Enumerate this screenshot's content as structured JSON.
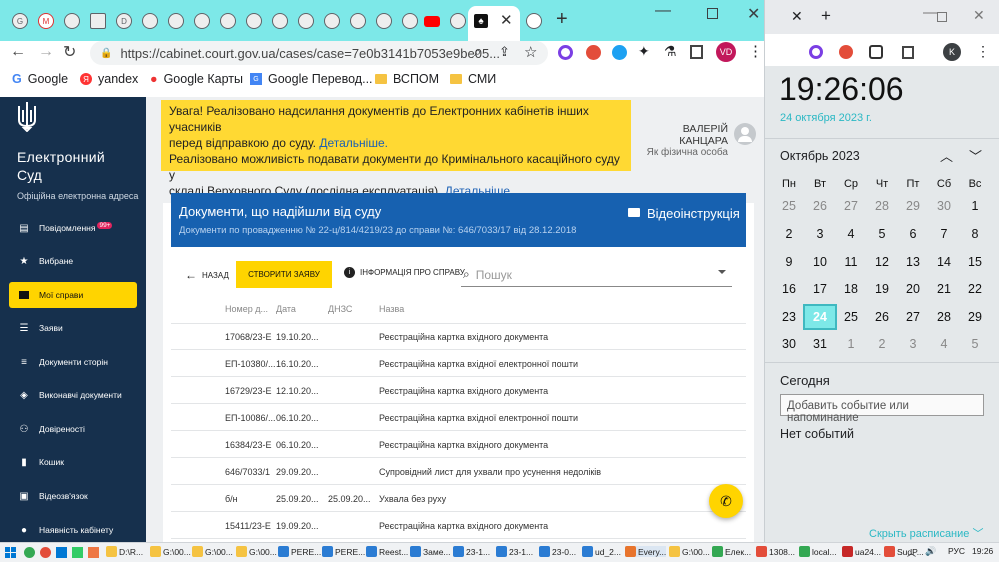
{
  "browser": {
    "address": "https://cabinet.court.gov.ua/cases/case=7e0b3141b7053e9be05...",
    "profile_initials": "VD",
    "bookmarks": [
      "Google",
      "yandex",
      "Google Карты",
      "Google Перевод...",
      "ВСПОМ",
      "СМИ"
    ],
    "brand_color": "#7de8e8"
  },
  "sidebar": {
    "brand_line1": "Електронний",
    "brand_line2": "Суд",
    "subtitle": "Офіційна електронна адреса",
    "items": [
      {
        "label": "Повідомлення",
        "badge": "99+",
        "icon": "chat-icon"
      },
      {
        "label": "Вибране",
        "icon": "star-icon"
      },
      {
        "label": "Мої справи",
        "icon": "folder-icon"
      },
      {
        "label": "Заяви",
        "icon": "list-icon"
      },
      {
        "label": "Документи сторін",
        "icon": "document-icon"
      },
      {
        "label": "Виконавчі документи",
        "icon": "stack-icon"
      },
      {
        "label": "Довіреності",
        "icon": "people-icon"
      },
      {
        "label": "Кошик",
        "icon": "trash-icon"
      },
      {
        "label": "Відеозв'язок",
        "icon": "video-icon"
      },
      {
        "label": "Наявність кабінету",
        "icon": "person-icon"
      }
    ]
  },
  "notice": {
    "line1": "Увага! Реалізовано надсилання документів до Електронних кабінетів інших учасників",
    "line2a": "перед відправкою до суду.",
    "link": "Детальніше.",
    "line3": "Реалізовано можливість подавати документи до Кримінального касаційного суду у",
    "line4a": "складі Верховного Суду (дослідна експлуатація).",
    "link2": "Детальніше."
  },
  "user": {
    "name": "ВАЛЕРІЙ КАНЦАРА",
    "role": "Як фізична особа"
  },
  "panel": {
    "title": "Документи, що надійшли від суду",
    "subtitle": "Документи по провадженню № 22-ц/814/4219/23 до справи №: 646/7033/17 від 28.12.2018",
    "video_label": "Відеоінструкція",
    "back_label": "НАЗАД",
    "create_label": "СТВОРИТИ ЗАЯВУ",
    "info_label": "ІНФОРМАЦІЯ ПРО СПРАВУ",
    "search_placeholder": "Пошук"
  },
  "table": {
    "headers": [
      "Номер д...",
      "Дата",
      "ДНЗС",
      "Назва"
    ],
    "rows": [
      [
        "17068/23-Е",
        "19.10.20...",
        "",
        "Реєстраційна картка вхідного документа"
      ],
      [
        "ЕП-10380/...",
        "16.10.20...",
        "",
        "Реєстраційна картка вхідної електронної пошти"
      ],
      [
        "16729/23-Е",
        "12.10.20...",
        "",
        "Реєстраційна картка вхідного документа"
      ],
      [
        "ЕП-10086/...",
        "06.10.20...",
        "",
        "Реєстраційна картка вхідної електронної пошти"
      ],
      [
        "16384/23-Е",
        "06.10.20...",
        "",
        "Реєстраційна картка вхідного документа"
      ],
      [
        "646/7033/1",
        "29.09.20...",
        "",
        "Супровідний лист для ухвали про усунення недоліків"
      ],
      [
        "б/н",
        "25.09.20...",
        "25.09.20...",
        "Ухвала без руху"
      ],
      [
        "15411/23-Е",
        "19.09.20...",
        "",
        "Реєстраційна картка вхідного документа"
      ]
    ]
  },
  "calendar": {
    "time": "19:26:06",
    "date": "24 октября 2023 г.",
    "month": "Октябрь 2023",
    "dows": [
      "Пн",
      "Вт",
      "Ср",
      "Чт",
      "Пт",
      "Сб",
      "Вс"
    ],
    "weeks": [
      [
        [
          "25",
          1
        ],
        [
          "26",
          1
        ],
        [
          "27",
          1
        ],
        [
          "28",
          1
        ],
        [
          "29",
          1
        ],
        [
          "30",
          1
        ],
        [
          "1",
          0
        ]
      ],
      [
        [
          "2",
          0
        ],
        [
          "3",
          0
        ],
        [
          "4",
          0
        ],
        [
          "5",
          0
        ],
        [
          "6",
          0
        ],
        [
          "7",
          0
        ],
        [
          "8",
          0
        ]
      ],
      [
        [
          "9",
          0
        ],
        [
          "10",
          0
        ],
        [
          "11",
          0
        ],
        [
          "12",
          0
        ],
        [
          "13",
          0
        ],
        [
          "14",
          0
        ],
        [
          "15",
          0
        ]
      ],
      [
        [
          "16",
          0
        ],
        [
          "17",
          0
        ],
        [
          "18",
          0
        ],
        [
          "19",
          0
        ],
        [
          "20",
          0
        ],
        [
          "21",
          0
        ],
        [
          "22",
          0
        ]
      ],
      [
        [
          "23",
          0
        ],
        [
          "24",
          2
        ],
        [
          "25",
          0
        ],
        [
          "26",
          0
        ],
        [
          "27",
          0
        ],
        [
          "28",
          0
        ],
        [
          "29",
          0
        ]
      ],
      [
        [
          "30",
          0
        ],
        [
          "31",
          0
        ],
        [
          "1",
          1
        ],
        [
          "2",
          1
        ],
        [
          "3",
          1
        ],
        [
          "4",
          1
        ],
        [
          "5",
          1
        ]
      ]
    ],
    "today_label": "Сегодня",
    "event_placeholder": "Добавить событие или напоминание",
    "no_events": "Нет событий",
    "hide_schedule": "Скрыть расписание",
    "profile_initial": "K"
  },
  "taskbar": {
    "items": [
      "D:\\R...",
      "G:\\00...",
      "G:\\00...",
      "G:\\00...",
      "PERE...",
      "PERE...",
      "Reest...",
      "Заме...",
      "23-1...",
      "23-1...",
      "23-0...",
      "ud_2...",
      "Every...",
      "G:\\00...",
      "Елек...",
      "1308...",
      "local...",
      "ua24...",
      "SudP..."
    ],
    "lang": "РУС",
    "clock": "19:26"
  }
}
